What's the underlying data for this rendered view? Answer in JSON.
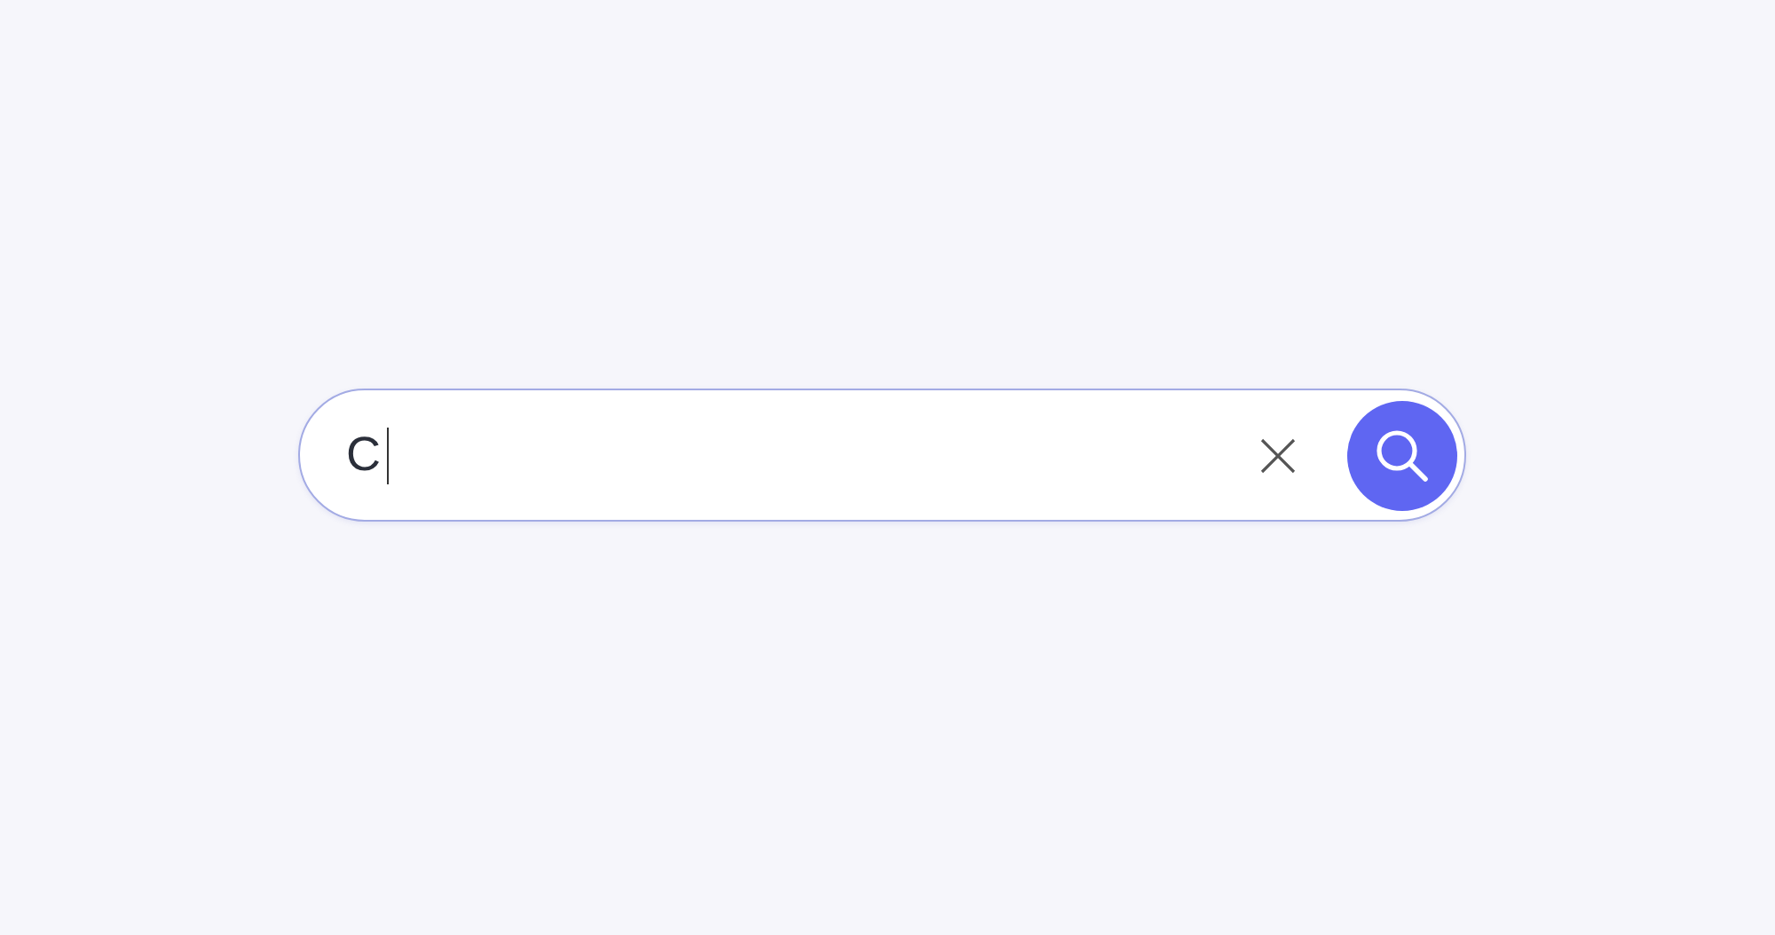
{
  "search": {
    "value": "C",
    "focused": true
  }
}
